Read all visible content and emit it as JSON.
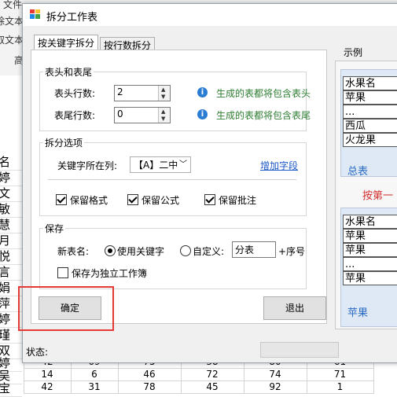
{
  "background": {
    "ribbon_fragments": [
      "文件",
      "除文本",
      "取文本",
      "高"
    ],
    "row_header_chars": [
      "名",
      "婷",
      "文",
      "敏",
      "慧",
      "月",
      "悦",
      "言",
      "娟",
      "萍",
      "婷",
      "瑾",
      "双",
      "婷",
      "吴",
      "宝"
    ],
    "grid_rows": [
      [
        "42",
        "69",
        "75",
        "38",
        "80",
        "61"
      ],
      [
        "14",
        "6",
        "46",
        "72",
        "74",
        "71"
      ],
      [
        "42",
        "31",
        "78",
        "45",
        "92",
        "1"
      ]
    ]
  },
  "dialog": {
    "title": "拆分工作表",
    "tabs": [
      "按关键字拆分",
      "按行数拆分"
    ],
    "header_footer": {
      "title": "表头和表尾",
      "header_rows_label": "表头行数:",
      "header_rows_value": "2",
      "header_note": "生成的表都将包含表头",
      "footer_rows_label": "表尾行数:",
      "footer_rows_value": "0",
      "footer_note": "生成的表都将包含表尾"
    },
    "split_options": {
      "title": "拆分选项",
      "key_col_label": "关键字所在列:",
      "key_col_value": "【A】二中",
      "add_field_link": "增加字段",
      "keep_format": "保留格式",
      "keep_formula": "保留公式",
      "keep_comment": "保留批注"
    },
    "save": {
      "title": "保存",
      "new_name_label": "新表名:",
      "use_keyword": "使用关键字",
      "custom": "自定义:",
      "custom_value": "分表",
      "suffix": "+序号",
      "save_independent": "保存为独立工作簿"
    },
    "ok_label": "确定",
    "exit_label": "退出",
    "status_label": "状态:",
    "example": {
      "title": "示例",
      "top_table": [
        "水果名",
        "苹果",
        "...",
        "西瓜",
        "火龙果"
      ],
      "top_tab": "总表",
      "split_note": "按第一",
      "bottom_table": [
        "水果名",
        "苹果",
        "苹果",
        "...",
        "苹果"
      ],
      "bottom_tab": "苹果"
    }
  },
  "colors": {
    "accent_red": "#e53935",
    "link_blue": "#1a56c9",
    "note_green": "#2e7d32"
  }
}
